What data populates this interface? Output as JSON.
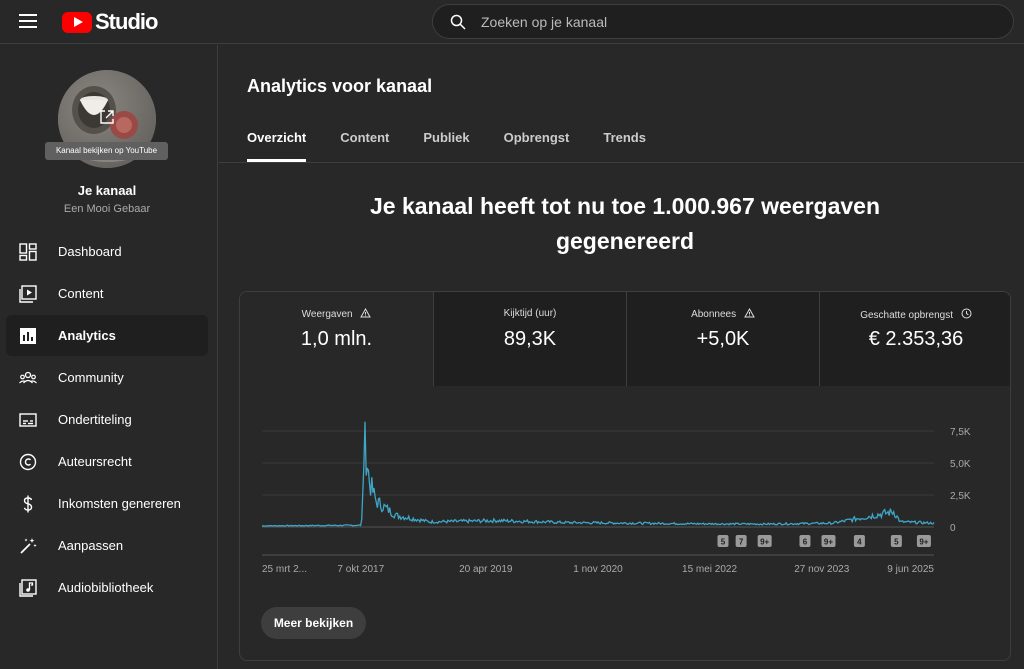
{
  "app": {
    "logo_text": "Studio",
    "search_placeholder": "Zoeken op je kanaal"
  },
  "sidebar": {
    "avatar_tooltip": "Kanaal bekijken op YouTube",
    "channel_title": "Je kanaal",
    "channel_name": "Een Mooi Gebaar",
    "items": [
      {
        "label": "Dashboard",
        "icon": "dashboard-icon"
      },
      {
        "label": "Content",
        "icon": "content-icon"
      },
      {
        "label": "Analytics",
        "icon": "analytics-icon",
        "active": true
      },
      {
        "label": "Community",
        "icon": "community-icon"
      },
      {
        "label": "Ondertiteling",
        "icon": "subtitles-icon"
      },
      {
        "label": "Auteursrecht",
        "icon": "copyright-icon"
      },
      {
        "label": "Inkomsten genereren",
        "icon": "dollar-icon"
      },
      {
        "label": "Aanpassen",
        "icon": "magic-wand-icon"
      },
      {
        "label": "Audiobibliotheek",
        "icon": "music-library-icon"
      }
    ]
  },
  "main": {
    "title": "Analytics voor kanaal",
    "tabs": [
      "Overzicht",
      "Content",
      "Publiek",
      "Opbrengst",
      "Trends"
    ],
    "headline": "Je kanaal heeft tot nu toe 1.000.967 weergaven gegenereerd",
    "metrics": [
      {
        "label": "Weergaven",
        "value": "1,0 mln.",
        "icon": "warning-icon"
      },
      {
        "label": "Kijktijd (uur)",
        "value": "89,3K"
      },
      {
        "label": "Abonnees",
        "value": "+5,0K",
        "icon": "warning-icon"
      },
      {
        "label": "Geschatte opbrengst",
        "value": "€ 2.353,36",
        "icon": "clock-icon"
      }
    ],
    "more_button": "Meer bekijken"
  },
  "chart_data": {
    "type": "line",
    "series_color": "#3ea6c7",
    "y_ticks": [
      "7,5K",
      "5,0K",
      "2,5K",
      "0"
    ],
    "ylim": [
      0,
      7500
    ],
    "x_tick_labels": [
      "25 mrt 2...",
      "7 okt 2017",
      "20 apr 2019",
      "1 nov 2020",
      "15 mei 2022",
      "27 nov 2023",
      "9 jun 2025"
    ],
    "x_range_fraction_points": [
      [
        0.0,
        100
      ],
      [
        0.148,
        150
      ],
      [
        0.153,
        6600
      ],
      [
        0.16,
        3500
      ],
      [
        0.17,
        2000
      ],
      [
        0.2,
        900
      ],
      [
        0.25,
        400
      ],
      [
        0.35,
        500
      ],
      [
        0.45,
        350
      ],
      [
        0.55,
        300
      ],
      [
        0.65,
        250
      ],
      [
        0.75,
        230
      ],
      [
        0.85,
        300
      ],
      [
        0.94,
        1200
      ],
      [
        0.95,
        400
      ],
      [
        1.0,
        300
      ]
    ],
    "annotations": [
      {
        "label": "5",
        "x_fraction": 0.686
      },
      {
        "label": "7",
        "x_fraction": 0.713
      },
      {
        "label": "9+",
        "x_fraction": 0.748
      },
      {
        "label": "6",
        "x_fraction": 0.808
      },
      {
        "label": "9+",
        "x_fraction": 0.843
      },
      {
        "label": "4",
        "x_fraction": 0.889
      },
      {
        "label": "5",
        "x_fraction": 0.944
      },
      {
        "label": "9+",
        "x_fraction": 0.985
      }
    ]
  }
}
